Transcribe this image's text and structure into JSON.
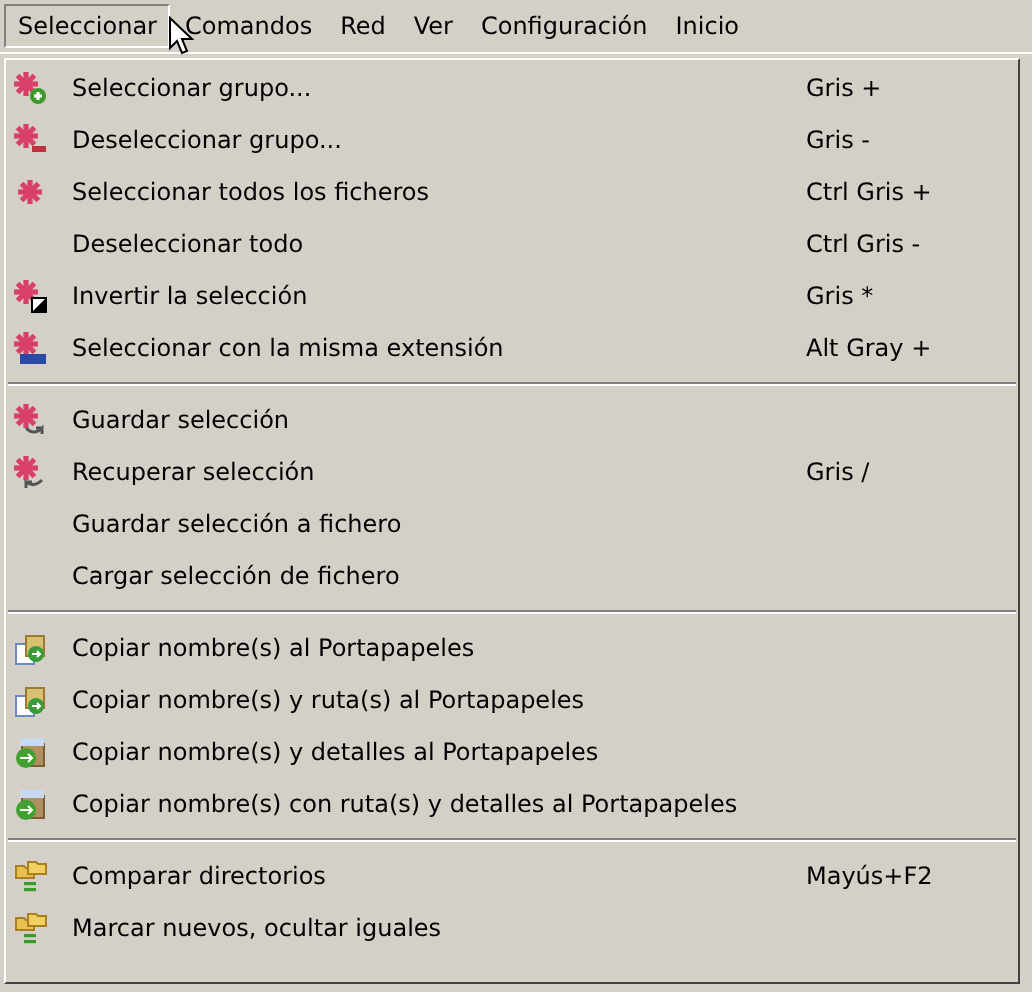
{
  "menu_bar": [
    {
      "label": "Seleccionar",
      "selected": true
    },
    {
      "label": "Comandos",
      "selected": false
    },
    {
      "label": "Red",
      "selected": false
    },
    {
      "label": "Ver",
      "selected": false
    },
    {
      "label": "Configuración",
      "selected": false
    },
    {
      "label": "Inicio",
      "selected": false
    }
  ],
  "menu": {
    "groups": [
      {
        "items": [
          {
            "label": "Seleccionar grupo...",
            "shortcut": "Gris +",
            "kind": "star-plus"
          },
          {
            "label": "Deseleccionar grupo...",
            "shortcut": "Gris -",
            "kind": "star-minus"
          },
          {
            "label": "Seleccionar todos los ficheros",
            "shortcut": "Ctrl Gris +",
            "kind": "star"
          },
          {
            "label": "Deseleccionar todo",
            "shortcut": "Ctrl Gris -"
          },
          {
            "label": "Invertir la selección",
            "shortcut": "Gris *",
            "kind": "star-invert"
          },
          {
            "label": "Seleccionar con la misma extensión",
            "shortcut": "Alt Gray +",
            "kind": "star-ext"
          }
        ]
      },
      {
        "items": [
          {
            "label": "Guardar selección",
            "kind": "star-save"
          },
          {
            "label": "Recuperar selección",
            "shortcut": "Gris /",
            "kind": "star-load"
          },
          {
            "label": "Guardar selección a fichero"
          },
          {
            "label": "Cargar selección de fichero"
          }
        ]
      },
      {
        "items": [
          {
            "label": "Copiar nombre(s) al Portapapeles",
            "kind": "clip-names"
          },
          {
            "label": "Copiar nombre(s) y ruta(s) al Portapapeles",
            "kind": "clip-names"
          },
          {
            "label": "Copiar nombre(s) y detalles al Portapapeles",
            "kind": "clip-details"
          },
          {
            "label": "Copiar nombre(s) con ruta(s) y detalles al Portapapeles",
            "kind": "clip-details"
          }
        ]
      },
      {
        "items": [
          {
            "label": "Comparar directorios",
            "shortcut": "Mayús+F2",
            "kind": "folders"
          },
          {
            "label": "Marcar nuevos, ocultar iguales",
            "kind": "folders"
          }
        ]
      }
    ]
  }
}
